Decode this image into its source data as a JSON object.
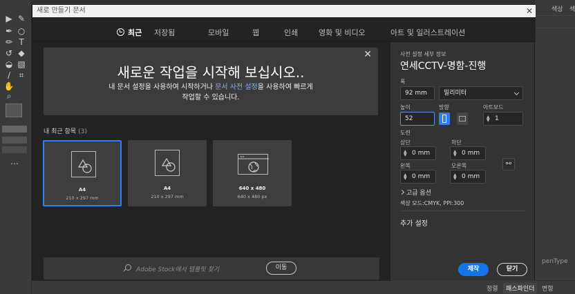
{
  "dialog": {
    "title": "새로 만들기 문서"
  },
  "tabs": [
    "최근",
    "저장됨",
    "모바일",
    "웹",
    "인쇄",
    "영화 및 비디오",
    "아트 및 일러스트레이션"
  ],
  "welcome": {
    "heading": "새로운 작업을 시작해 보십시오..",
    "line1_a": "내 문서 설정을 사용하여 시작하거나 ",
    "line1_link": "문서 사전 설정",
    "line1_b": "을 사용하여 빠르게",
    "line2": "작업할 수 있습니다."
  },
  "recent": {
    "title": "내 최근 항목",
    "count": "(3)",
    "items": [
      {
        "name": "A4",
        "dims": "210 x 297 mm",
        "icon": "document-shapes-icon"
      },
      {
        "name": "A4",
        "dims": "210 x 297 mm",
        "icon": "document-shapes-icon"
      },
      {
        "name": "640 x 480",
        "dims": "640 x 480 px",
        "icon": "web-globe-icon"
      }
    ]
  },
  "search": {
    "placeholder": "Adobe Stock에서 템플릿 찾기",
    "go_label": "이동"
  },
  "details": {
    "section_title": "사전 설정 세부 정보",
    "preset_name": "연세CCTV-명함-진행",
    "width_label": "폭",
    "width_value": "92 mm",
    "unit_value": "밀리미터",
    "height_label": "높이",
    "height_value": "52",
    "orientation_label": "방향",
    "artboard_label": "아트보드",
    "artboard_value": "1",
    "bleed_label": "도련",
    "top_label": "상단",
    "top_value": "0 mm",
    "bottom_label": "하단",
    "bottom_value": "0 mm",
    "left_label": "왼쪽",
    "left_value": "0 mm",
    "right_label": "오른쪽",
    "right_value": "0 mm",
    "advanced_label": "고급 옵션",
    "color_mode": "색상 모드:CMYK, PPI:300",
    "more_settings": "추가 설정",
    "create_label": "제작",
    "close_label": "닫기"
  },
  "app": {
    "right_tabs": [
      "색상",
      "색상 안내"
    ],
    "right_label": "penType",
    "bottom_tabs": [
      "정렬",
      "패스파인더",
      "변형"
    ]
  },
  "colors": {
    "accent": "#1473e6",
    "selection": "#2f80ed"
  }
}
